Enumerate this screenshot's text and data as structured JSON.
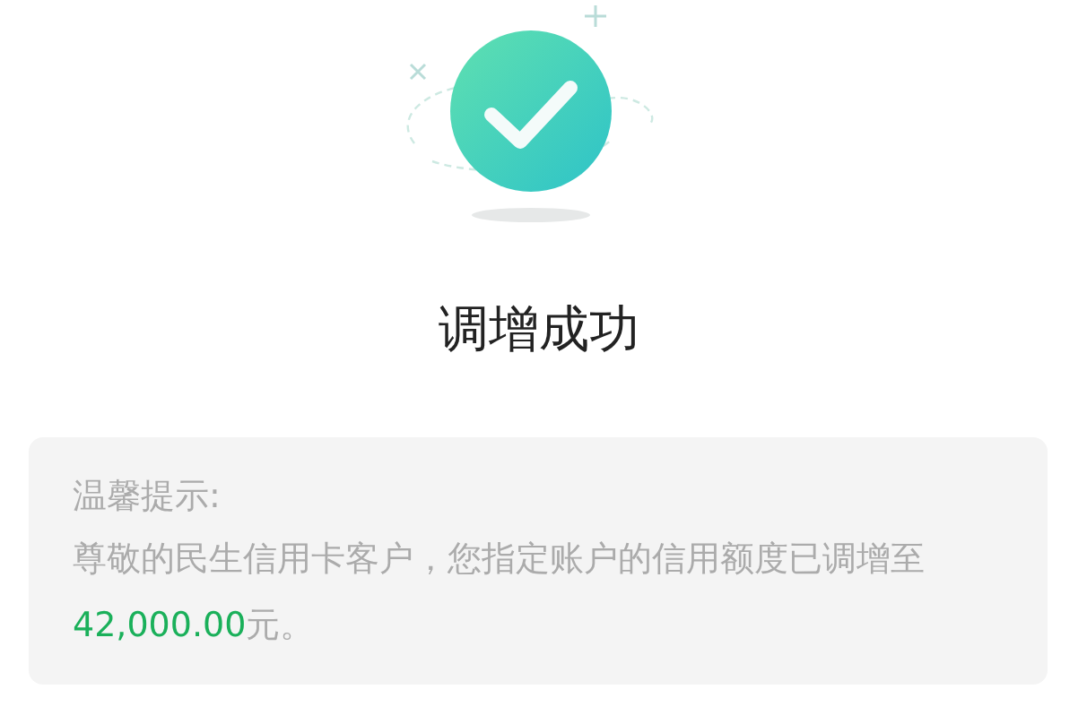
{
  "result": {
    "title": "调增成功"
  },
  "notice": {
    "heading": "温馨提示:",
    "message_before": "尊敬的民生信用卡客户，您指定账户的信用额度已调增至",
    "amount": "42,000.00",
    "message_after": "元。"
  }
}
